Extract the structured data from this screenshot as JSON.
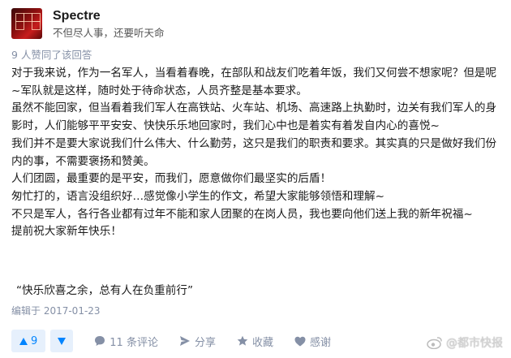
{
  "author": {
    "name": "Spectre",
    "bio": "不但尽人事，还要听天命"
  },
  "votes_text": "9 人赞同了该回答",
  "paragraphs": [
    "对于我来说，作为一名军人，当看着春晚，在部队和战友们吃着年饭，我们又何尝不想家呢？但是呢~军队就是这样，随时处于待命状态，人员齐整是基本要求。",
    "虽然不能回家，但当看着我们军人在高铁站、火车站、机场、高速路上执勤时，边关有我们军人的身影时，人们能够平平安安、快快乐乐地回家时，我们心中也是着实有着发自内心的喜悦~",
    "我们并不是要大家说我们什么伟大、什么勤劳，这只是我们的职责和要求。其实真的只是做好我们份内的事，不需要褒扬和赞美。",
    "人们团圆，最重要的是平安，而我们，愿意做你们最坚实的后盾！",
    "匆忙打的，语言没组织好…感觉像小学生的作文，希望大家能够领悟和理解~",
    "不只是军人，各行各业都有过年不能和家人团聚的在岗人员，我也要向他们送上我的新年祝福~",
    "提前祝大家新年快乐！"
  ],
  "quote": "“快乐欣喜之余，总有人在负重前行”",
  "edited": "编辑于 2017-01-23",
  "actions": {
    "upvote_count": "9",
    "comments": "11 条评论",
    "share": "分享",
    "favorite": "收藏",
    "thanks": "感谢"
  },
  "watermark": "@都市快报",
  "colors": {
    "accent": "#0084ff",
    "accent_bg": "#e6f0fc",
    "meta": "#8590a6"
  },
  "icons": [
    "up-arrow-icon",
    "down-arrow-icon",
    "comment-icon",
    "share-icon",
    "star-icon",
    "heart-icon",
    "weibo-icon"
  ]
}
